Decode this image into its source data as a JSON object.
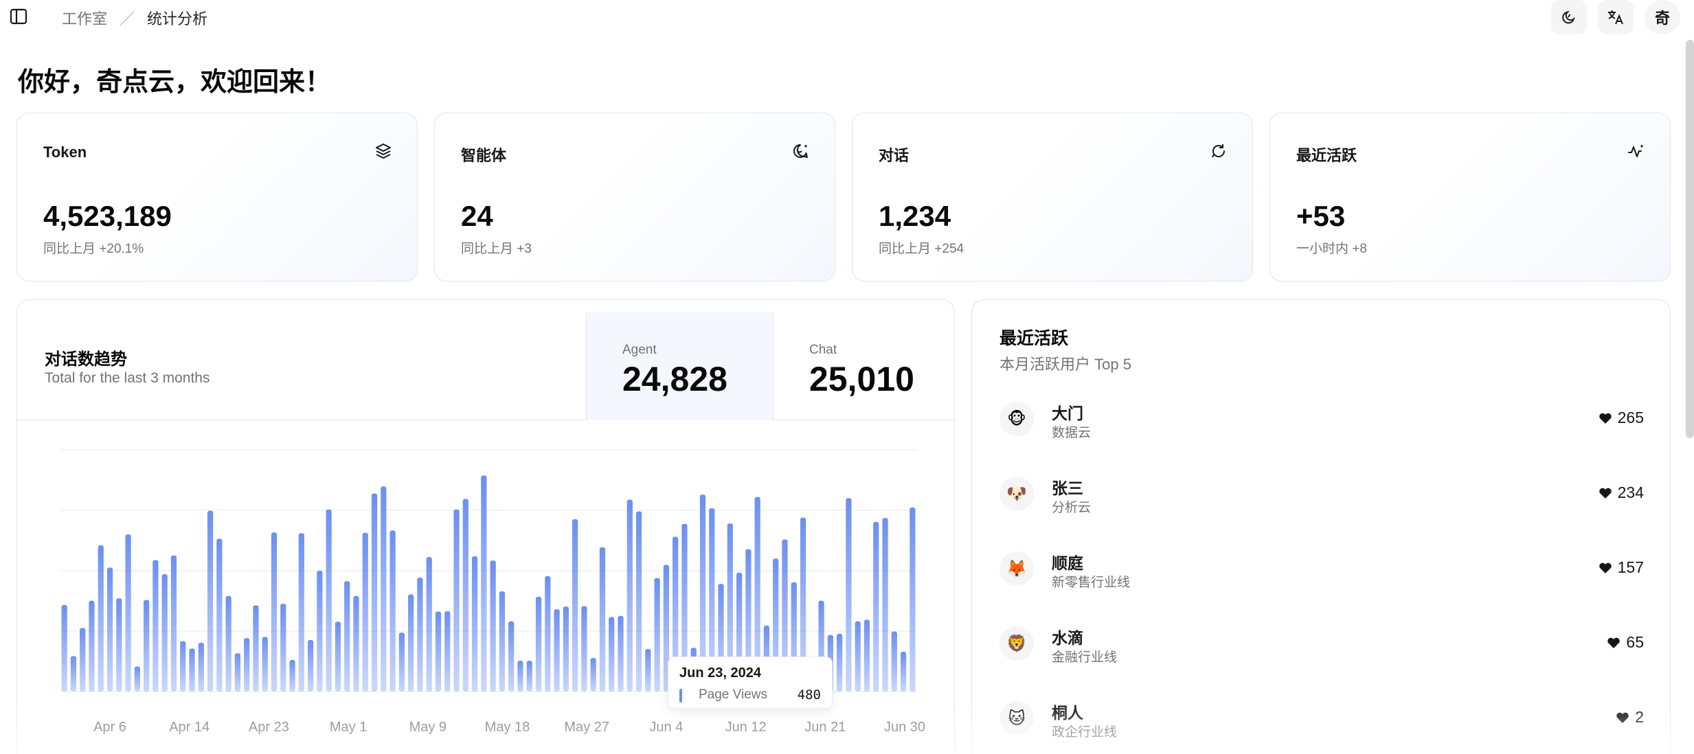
{
  "breadcrumb": {
    "root": "工作室",
    "separator": "／",
    "current": "统计分析"
  },
  "top_actions": {
    "avatar_text": "奇"
  },
  "greeting": "你好，奇点云，欢迎回来！",
  "stats": [
    {
      "label": "Token",
      "value": "4,523,189",
      "sub": "同比上月 +20.1%",
      "icon": "layers-icon"
    },
    {
      "label": "智能体",
      "value": "24",
      "sub": "同比上月 +3",
      "icon": "bot-icon"
    },
    {
      "label": "对话",
      "value": "1,234",
      "sub": "同比上月 +254",
      "icon": "chat-icon"
    },
    {
      "label": "最近活跃",
      "value": "+53",
      "sub": "一小时内 +8",
      "icon": "activity-icon"
    }
  ],
  "chart": {
    "title": "对话数趋势",
    "description": "Total for the last 3 months",
    "metrics": [
      {
        "label": "Agent",
        "value": "24,828"
      },
      {
        "label": "Chat",
        "value": "25,010"
      }
    ],
    "tooltip": {
      "date": "Jun 23, 2024",
      "label": "Page Views",
      "value": "480"
    }
  },
  "chart_data": {
    "type": "bar",
    "x_tick_labels": [
      "Apr 6",
      "Apr 14",
      "Apr 23",
      "May 1",
      "May 9",
      "May 18",
      "May 27",
      "Jun 4",
      "Jun 12",
      "Jun 21",
      "Jun 30"
    ],
    "values": [
      222,
      91,
      163,
      233,
      375,
      318,
      239,
      403,
      64,
      235,
      337,
      301,
      349,
      129,
      110,
      125,
      464,
      392,
      245,
      98,
      137,
      221,
      140,
      408,
      225,
      81,
      406,
      132,
      310,
      467,
      179,
      283,
      245,
      407,
      508,
      526,
      413,
      151,
      249,
      292,
      345,
      205,
      206,
      467,
      494,
      347,
      554,
      336,
      257,
      180,
      79,
      79,
      243,
      296,
      211,
      218,
      442,
      219,
      86,
      370,
      191,
      194,
      492,
      462,
      109,
      291,
      325,
      397,
      430,
      112,
      505,
      470,
      276,
      431,
      305,
      365,
      499,
      169,
      341,
      390,
      280,
      446,
      64,
      233,
      145,
      148,
      496,
      180,
      184,
      435,
      445,
      154,
      102,
      472
    ],
    "ylim": [
      0,
      620
    ],
    "grid": true,
    "color": "#6b8ff2"
  },
  "activity": {
    "title": "最近活跃",
    "description": "本月活跃用户 Top 5",
    "users": [
      {
        "avatar": "🐵",
        "name": "大门",
        "org": "数据云",
        "score": "265"
      },
      {
        "avatar": "🐶",
        "name": "张三",
        "org": "分析云",
        "score": "234"
      },
      {
        "avatar": "🦊",
        "name": "顺庭",
        "org": "新零售行业线",
        "score": "157"
      },
      {
        "avatar": "🦁",
        "name": "水滴",
        "org": "金融行业线",
        "score": "65"
      },
      {
        "avatar": "🐱",
        "name": "桐人",
        "org": "政企行业线",
        "score": "2"
      }
    ]
  }
}
